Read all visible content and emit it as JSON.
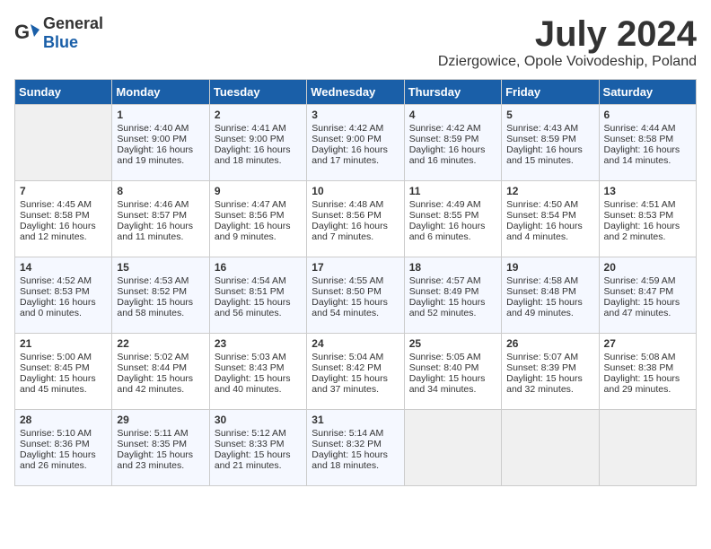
{
  "header": {
    "logo_general": "General",
    "logo_blue": "Blue",
    "month_title": "July 2024",
    "location": "Dziergowice, Opole Voivodeship, Poland"
  },
  "weekdays": [
    "Sunday",
    "Monday",
    "Tuesday",
    "Wednesday",
    "Thursday",
    "Friday",
    "Saturday"
  ],
  "weeks": [
    [
      {
        "day": "",
        "content": ""
      },
      {
        "day": "1",
        "content": "Sunrise: 4:40 AM\nSunset: 9:00 PM\nDaylight: 16 hours\nand 19 minutes."
      },
      {
        "day": "2",
        "content": "Sunrise: 4:41 AM\nSunset: 9:00 PM\nDaylight: 16 hours\nand 18 minutes."
      },
      {
        "day": "3",
        "content": "Sunrise: 4:42 AM\nSunset: 9:00 PM\nDaylight: 16 hours\nand 17 minutes."
      },
      {
        "day": "4",
        "content": "Sunrise: 4:42 AM\nSunset: 8:59 PM\nDaylight: 16 hours\nand 16 minutes."
      },
      {
        "day": "5",
        "content": "Sunrise: 4:43 AM\nSunset: 8:59 PM\nDaylight: 16 hours\nand 15 minutes."
      },
      {
        "day": "6",
        "content": "Sunrise: 4:44 AM\nSunset: 8:58 PM\nDaylight: 16 hours\nand 14 minutes."
      }
    ],
    [
      {
        "day": "7",
        "content": "Sunrise: 4:45 AM\nSunset: 8:58 PM\nDaylight: 16 hours\nand 12 minutes."
      },
      {
        "day": "8",
        "content": "Sunrise: 4:46 AM\nSunset: 8:57 PM\nDaylight: 16 hours\nand 11 minutes."
      },
      {
        "day": "9",
        "content": "Sunrise: 4:47 AM\nSunset: 8:56 PM\nDaylight: 16 hours\nand 9 minutes."
      },
      {
        "day": "10",
        "content": "Sunrise: 4:48 AM\nSunset: 8:56 PM\nDaylight: 16 hours\nand 7 minutes."
      },
      {
        "day": "11",
        "content": "Sunrise: 4:49 AM\nSunset: 8:55 PM\nDaylight: 16 hours\nand 6 minutes."
      },
      {
        "day": "12",
        "content": "Sunrise: 4:50 AM\nSunset: 8:54 PM\nDaylight: 16 hours\nand 4 minutes."
      },
      {
        "day": "13",
        "content": "Sunrise: 4:51 AM\nSunset: 8:53 PM\nDaylight: 16 hours\nand 2 minutes."
      }
    ],
    [
      {
        "day": "14",
        "content": "Sunrise: 4:52 AM\nSunset: 8:53 PM\nDaylight: 16 hours\nand 0 minutes."
      },
      {
        "day": "15",
        "content": "Sunrise: 4:53 AM\nSunset: 8:52 PM\nDaylight: 15 hours\nand 58 minutes."
      },
      {
        "day": "16",
        "content": "Sunrise: 4:54 AM\nSunset: 8:51 PM\nDaylight: 15 hours\nand 56 minutes."
      },
      {
        "day": "17",
        "content": "Sunrise: 4:55 AM\nSunset: 8:50 PM\nDaylight: 15 hours\nand 54 minutes."
      },
      {
        "day": "18",
        "content": "Sunrise: 4:57 AM\nSunset: 8:49 PM\nDaylight: 15 hours\nand 52 minutes."
      },
      {
        "day": "19",
        "content": "Sunrise: 4:58 AM\nSunset: 8:48 PM\nDaylight: 15 hours\nand 49 minutes."
      },
      {
        "day": "20",
        "content": "Sunrise: 4:59 AM\nSunset: 8:47 PM\nDaylight: 15 hours\nand 47 minutes."
      }
    ],
    [
      {
        "day": "21",
        "content": "Sunrise: 5:00 AM\nSunset: 8:45 PM\nDaylight: 15 hours\nand 45 minutes."
      },
      {
        "day": "22",
        "content": "Sunrise: 5:02 AM\nSunset: 8:44 PM\nDaylight: 15 hours\nand 42 minutes."
      },
      {
        "day": "23",
        "content": "Sunrise: 5:03 AM\nSunset: 8:43 PM\nDaylight: 15 hours\nand 40 minutes."
      },
      {
        "day": "24",
        "content": "Sunrise: 5:04 AM\nSunset: 8:42 PM\nDaylight: 15 hours\nand 37 minutes."
      },
      {
        "day": "25",
        "content": "Sunrise: 5:05 AM\nSunset: 8:40 PM\nDaylight: 15 hours\nand 34 minutes."
      },
      {
        "day": "26",
        "content": "Sunrise: 5:07 AM\nSunset: 8:39 PM\nDaylight: 15 hours\nand 32 minutes."
      },
      {
        "day": "27",
        "content": "Sunrise: 5:08 AM\nSunset: 8:38 PM\nDaylight: 15 hours\nand 29 minutes."
      }
    ],
    [
      {
        "day": "28",
        "content": "Sunrise: 5:10 AM\nSunset: 8:36 PM\nDaylight: 15 hours\nand 26 minutes."
      },
      {
        "day": "29",
        "content": "Sunrise: 5:11 AM\nSunset: 8:35 PM\nDaylight: 15 hours\nand 23 minutes."
      },
      {
        "day": "30",
        "content": "Sunrise: 5:12 AM\nSunset: 8:33 PM\nDaylight: 15 hours\nand 21 minutes."
      },
      {
        "day": "31",
        "content": "Sunrise: 5:14 AM\nSunset: 8:32 PM\nDaylight: 15 hours\nand 18 minutes."
      },
      {
        "day": "",
        "content": ""
      },
      {
        "day": "",
        "content": ""
      },
      {
        "day": "",
        "content": ""
      }
    ]
  ]
}
